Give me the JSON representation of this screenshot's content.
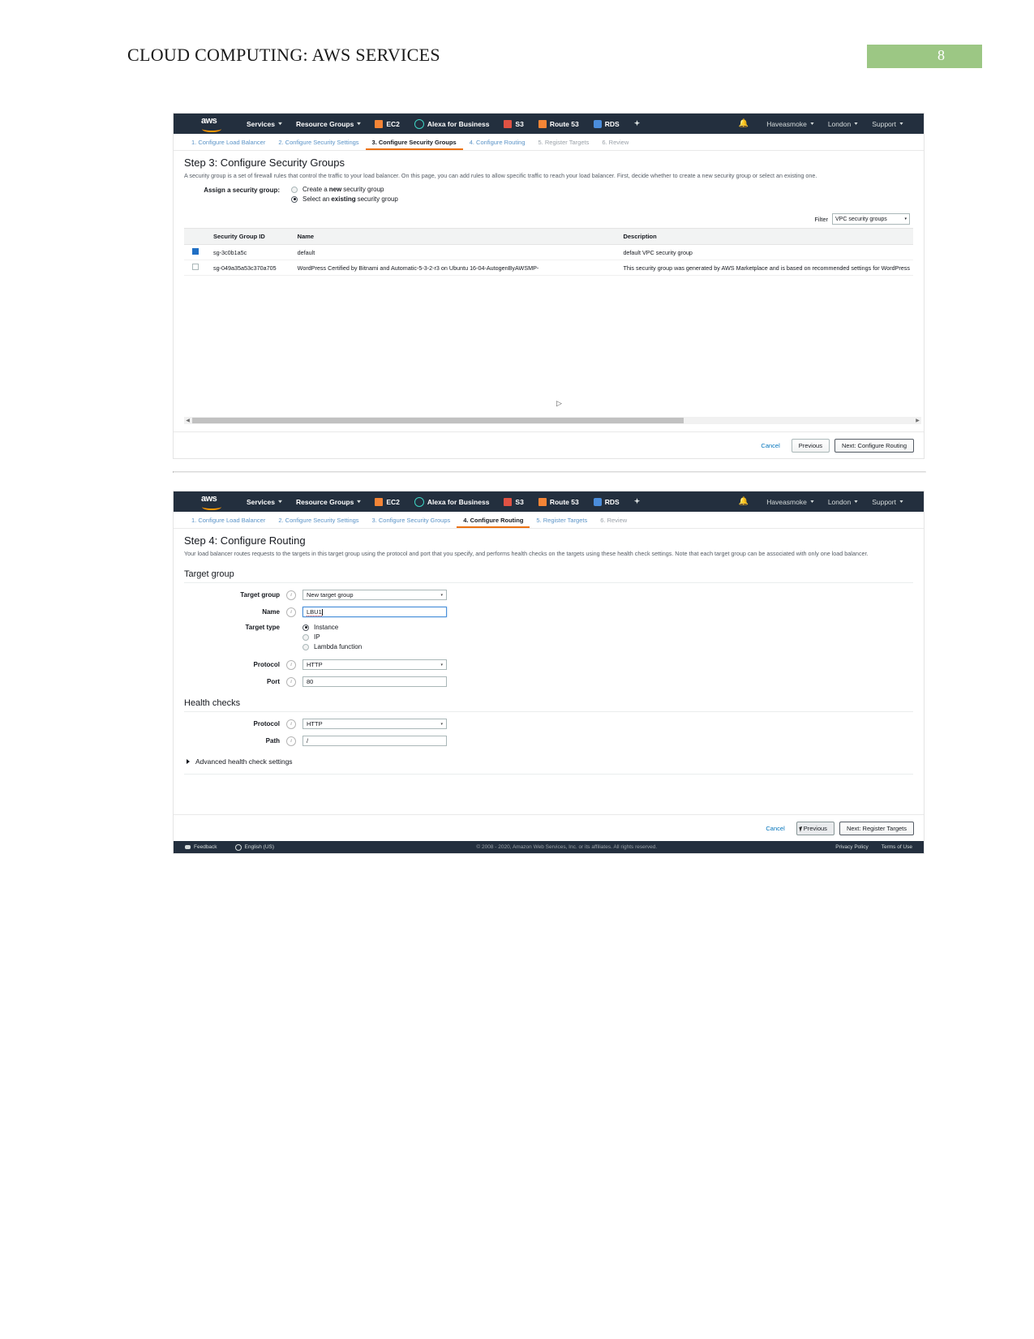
{
  "document": {
    "title": "CLOUD COMPUTING: AWS SERVICES",
    "page_number": "8",
    "badge_color": "#9cc784"
  },
  "aws_nav": {
    "logo": "aws",
    "items": [
      {
        "label": "Services",
        "icon": "none",
        "caret": true
      },
      {
        "label": "Resource Groups",
        "icon": "none",
        "caret": true
      },
      {
        "label": "EC2",
        "icon": "ec2-icon",
        "caret": false
      },
      {
        "label": "Alexa for Business",
        "icon": "alexa-icon",
        "caret": false
      },
      {
        "label": "S3",
        "icon": "s3-icon",
        "caret": false
      },
      {
        "label": "Route 53",
        "icon": "route53-icon",
        "caret": false
      },
      {
        "label": "RDS",
        "icon": "rds-icon",
        "caret": false
      }
    ],
    "pin_icon": "pin-icon",
    "bell_icon": "bell-icon",
    "account": "Haveasmoke",
    "region": "London",
    "support": "Support"
  },
  "panel_security": {
    "steps": [
      {
        "label": "1. Configure Load Balancer",
        "state": "link"
      },
      {
        "label": "2. Configure Security Settings",
        "state": "link"
      },
      {
        "label": "3. Configure Security Groups",
        "state": "active"
      },
      {
        "label": "4. Configure Routing",
        "state": "link"
      },
      {
        "label": "5. Register Targets",
        "state": "muted"
      },
      {
        "label": "6. Review",
        "state": "muted"
      }
    ],
    "title": "Step 3: Configure Security Groups",
    "description": "A security group is a set of firewall rules that control the traffic to your load balancer. On this page, you can add rules to allow specific traffic to reach your load balancer. First, decide whether to create a new security group or select an existing one.",
    "assign_label": "Assign a security group:",
    "options": [
      {
        "prefix": "Create a ",
        "strong": "new",
        "suffix": " security group",
        "checked": false
      },
      {
        "prefix": "Select an ",
        "strong": "existing",
        "suffix": " security group",
        "checked": true
      }
    ],
    "filter_label": "Filter",
    "filter_value": "VPC security groups",
    "table": {
      "headers": [
        "",
        "Security Group ID",
        "Name",
        "Description"
      ],
      "rows": [
        {
          "checked": true,
          "id": "sg-3c0b1a5c",
          "name": "default",
          "description": "default VPC security group"
        },
        {
          "checked": false,
          "id": "sg-049a35a53c370a705",
          "name": "WordPress Certified by Bitnami and Automatic-5-3-2-r3 on Ubuntu 16-04-AutogenByAWSMP-",
          "description": "This security group was generated by AWS Marketplace and is based on recommended settings for WordPress"
        }
      ]
    },
    "actions": {
      "cancel": "Cancel",
      "previous": "Previous",
      "next": "Next: Configure Routing"
    }
  },
  "panel_routing": {
    "steps": [
      {
        "label": "1. Configure Load Balancer",
        "state": "link"
      },
      {
        "label": "2. Configure Security Settings",
        "state": "link"
      },
      {
        "label": "3. Configure Security Groups",
        "state": "link"
      },
      {
        "label": "4. Configure Routing",
        "state": "active"
      },
      {
        "label": "5. Register Targets",
        "state": "link"
      },
      {
        "label": "6. Review",
        "state": "muted"
      }
    ],
    "title": "Step 4: Configure Routing",
    "description": "Your load balancer routes requests to the targets in this target group using the protocol and port that you specify, and performs health checks on the targets using these health check settings. Note that each target group can be associated with only one load balancer.",
    "target_group_section": "Target group",
    "fields": {
      "target_group_label": "Target group",
      "target_group_value": "New target group",
      "name_label": "Name",
      "name_value": "LBU1",
      "target_type_label": "Target type",
      "target_types": [
        {
          "label": "Instance",
          "checked": true
        },
        {
          "label": "IP",
          "checked": false
        },
        {
          "label": "Lambda function",
          "checked": false
        }
      ],
      "protocol_label": "Protocol",
      "protocol_value": "HTTP",
      "port_label": "Port",
      "port_value": "80"
    },
    "health_checks_section": "Health checks",
    "health": {
      "protocol_label": "Protocol",
      "protocol_value": "HTTP",
      "path_label": "Path",
      "path_value": "/"
    },
    "advanced_label": "Advanced health check settings",
    "actions": {
      "cancel": "Cancel",
      "previous": "Previous",
      "next": "Next: Register Targets"
    }
  },
  "aws_footer": {
    "feedback": "Feedback",
    "language": "English (US)",
    "copyright": "© 2008 - 2020, Amazon Web Services, Inc. or its affiliates. All rights reserved.",
    "privacy": "Privacy Policy",
    "terms": "Terms of Use"
  }
}
